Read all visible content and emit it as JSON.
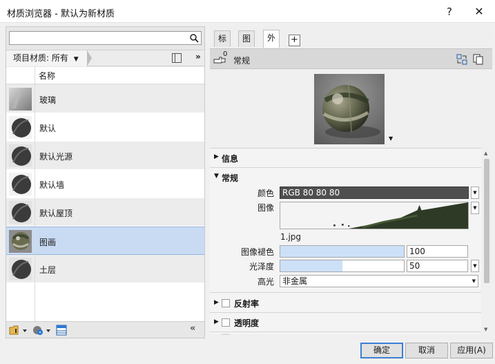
{
  "window": {
    "title": "材质浏览器 - 默认为新材质",
    "help_label": "?",
    "close_label": "✕"
  },
  "left": {
    "search": {
      "value": "",
      "placeholder": ""
    },
    "filter_label": "项目材质: 所有",
    "filter_arrow": "▼",
    "more_label": "»",
    "column_header": "名称",
    "materials": [
      {
        "name": "玻璃",
        "thumb": "glass"
      },
      {
        "name": "默认",
        "thumb": "dark-sphere"
      },
      {
        "name": "默认光源",
        "thumb": "dark-sphere"
      },
      {
        "name": "默认墙",
        "thumb": "dark-sphere"
      },
      {
        "name": "默认屋顶",
        "thumb": "dark-sphere"
      },
      {
        "name": "图画",
        "thumb": "image-sphere",
        "selected": true
      },
      {
        "name": "土层",
        "thumb": "dark-sphere"
      }
    ],
    "collapse_label": "«"
  },
  "right": {
    "tabs": [
      "标识",
      "图形",
      "外观"
    ],
    "active_tab": "外观",
    "add_tab_label": "+",
    "asset_count": "0",
    "asset_name": "常规",
    "sections": {
      "info": "信息",
      "general": "常规",
      "reflectivity": "反射率",
      "transparency": "透明度"
    },
    "props": {
      "color_label": "颜色",
      "color_value": "RGB 80 80 80",
      "image_label": "图像",
      "image_file": "1.jpg",
      "fade_label": "图像褪色",
      "fade_value": "100",
      "fade_fraction": 1.0,
      "gloss_label": "光泽度",
      "gloss_value": "50",
      "gloss_fraction": 0.5,
      "highlight_label": "高光",
      "highlight_value": "非金属"
    }
  },
  "buttons": {
    "ok": "确定",
    "cancel": "取消",
    "apply": "应用(A)"
  },
  "colors": {
    "selection": "#c9daf3",
    "color_swatch": "#505050",
    "slider_fill": "#cce1f8",
    "primary_border": "#3c7fd6"
  }
}
